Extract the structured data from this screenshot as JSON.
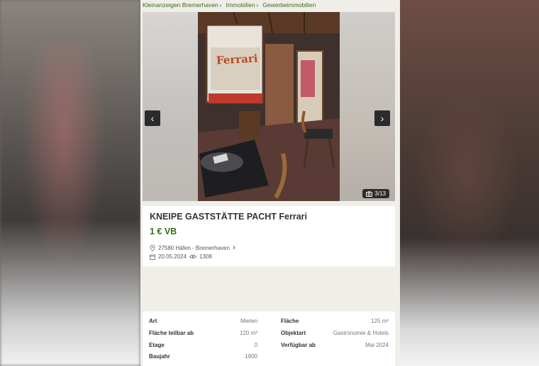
{
  "breadcrumb": [
    {
      "label": "Kleinanzeigen Bremerhaven"
    },
    {
      "label": "Immobilien"
    },
    {
      "label": "Gewerbeimmobilien"
    }
  ],
  "photo": {
    "sign_text": "Ferrari",
    "counter": "3/13"
  },
  "listing": {
    "title": "KNEIPE GASTSTÄTTE PACHT Ferrari",
    "price": "1 € VB",
    "location": "27580 Häfen - Bremerhaven",
    "date": "20.05.2024",
    "views": "1308"
  },
  "details": {
    "left": [
      {
        "key": "Art",
        "value": "Mieten"
      },
      {
        "key": "Fläche teilbar ab",
        "value": "120 m²"
      },
      {
        "key": "Etage",
        "value": "0"
      },
      {
        "key": "Baujahr",
        "value": "1900"
      }
    ],
    "right": [
      {
        "key": "Fläche",
        "value": "125 m²"
      },
      {
        "key": "Objektart",
        "value": "Gastronomie & Hotels"
      },
      {
        "key": "Verfügbar ab",
        "value": "Mai 2024"
      }
    ]
  },
  "colors": {
    "accent_green": "#3b6b1e",
    "page_bg": "#efeee9"
  }
}
